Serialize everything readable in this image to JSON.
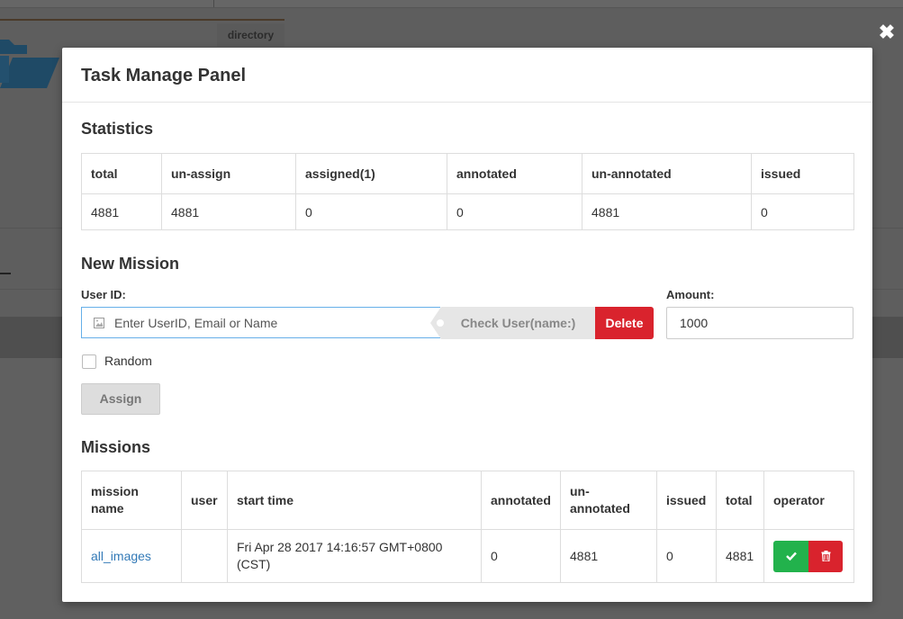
{
  "background": {
    "tab_label": "directory"
  },
  "modal": {
    "title": "Task Manage Panel",
    "close_icon": "close-icon"
  },
  "statistics": {
    "title": "Statistics",
    "headers": [
      "total",
      "un-assign",
      "assigned(1)",
      "annotated",
      "un-annotated",
      "issued"
    ],
    "values": [
      "4881",
      "4881",
      "0",
      "0",
      "4881",
      "0"
    ]
  },
  "new_mission": {
    "title": "New Mission",
    "user_id_label": "User ID:",
    "user_id_placeholder": "Enter UserID, Email or Name",
    "check_user_label": "Check User(name:)",
    "delete_label": "Delete",
    "amount_label": "Amount:",
    "amount_value": "1000",
    "random_label": "Random",
    "random_checked": false,
    "assign_label": "Assign"
  },
  "missions": {
    "title": "Missions",
    "headers": {
      "mission_name": "mission name",
      "user": "user",
      "start_time": "start time",
      "annotated": "annotated",
      "un_annotated": "un-annotated",
      "issued": "issued",
      "total": "total",
      "operator": "operator"
    },
    "rows": [
      {
        "mission_name": "all_images",
        "user": "",
        "start_time": "Fri Apr 28 2017 14:16:57 GMT+0800 (CST)",
        "annotated": "0",
        "un_annotated": "4881",
        "issued": "0",
        "total": "4881"
      }
    ]
  },
  "colors": {
    "accent_link": "#337ab7",
    "danger": "#d9232d",
    "success": "#22b24c",
    "overlay": "#5e5e5e"
  }
}
